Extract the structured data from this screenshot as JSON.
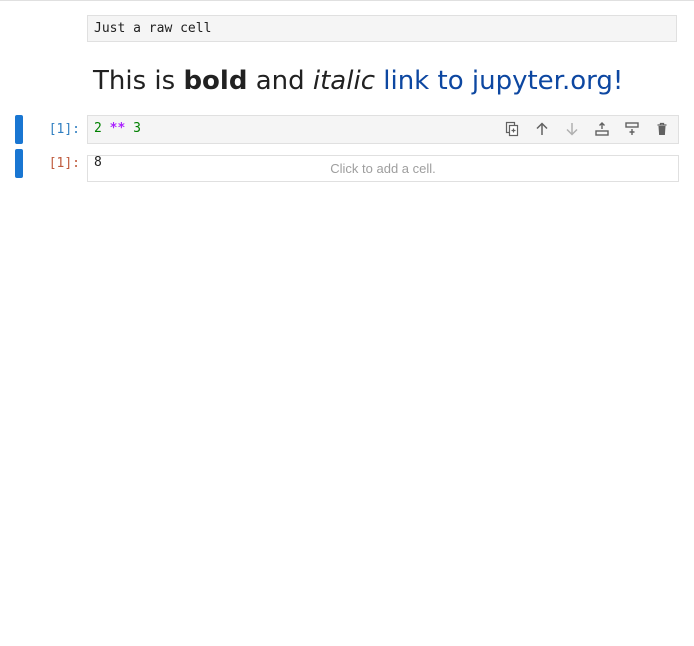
{
  "raw_cell": {
    "text": "Just a raw cell"
  },
  "markdown_cell": {
    "part1": "This is ",
    "bold": "bold",
    "part2": " and ",
    "italic": "italic",
    "link_text": "link to jupyter.org!"
  },
  "code_cell": {
    "input_prompt": "[1]:",
    "code": {
      "left": "2",
      "op": "**",
      "right": "3"
    },
    "toolbar": [
      {
        "name": "duplicate-cell",
        "icon": "duplicate-icon"
      },
      {
        "name": "move-cell-up",
        "icon": "arrow-up-icon"
      },
      {
        "name": "move-cell-down",
        "icon": "arrow-down-icon"
      },
      {
        "name": "insert-cell-above",
        "icon": "insert-above-icon"
      },
      {
        "name": "insert-cell-below",
        "icon": "insert-below-icon"
      },
      {
        "name": "delete-cell",
        "icon": "trash-icon"
      }
    ],
    "output_prompt": "[1]:",
    "output": "8"
  },
  "add_cell": {
    "label": "Click to add a cell."
  },
  "colors": {
    "collapser": "#1976d2",
    "link": "#0d47a1",
    "in_prompt": "#307fc1",
    "out_prompt": "#bf5b3d"
  }
}
